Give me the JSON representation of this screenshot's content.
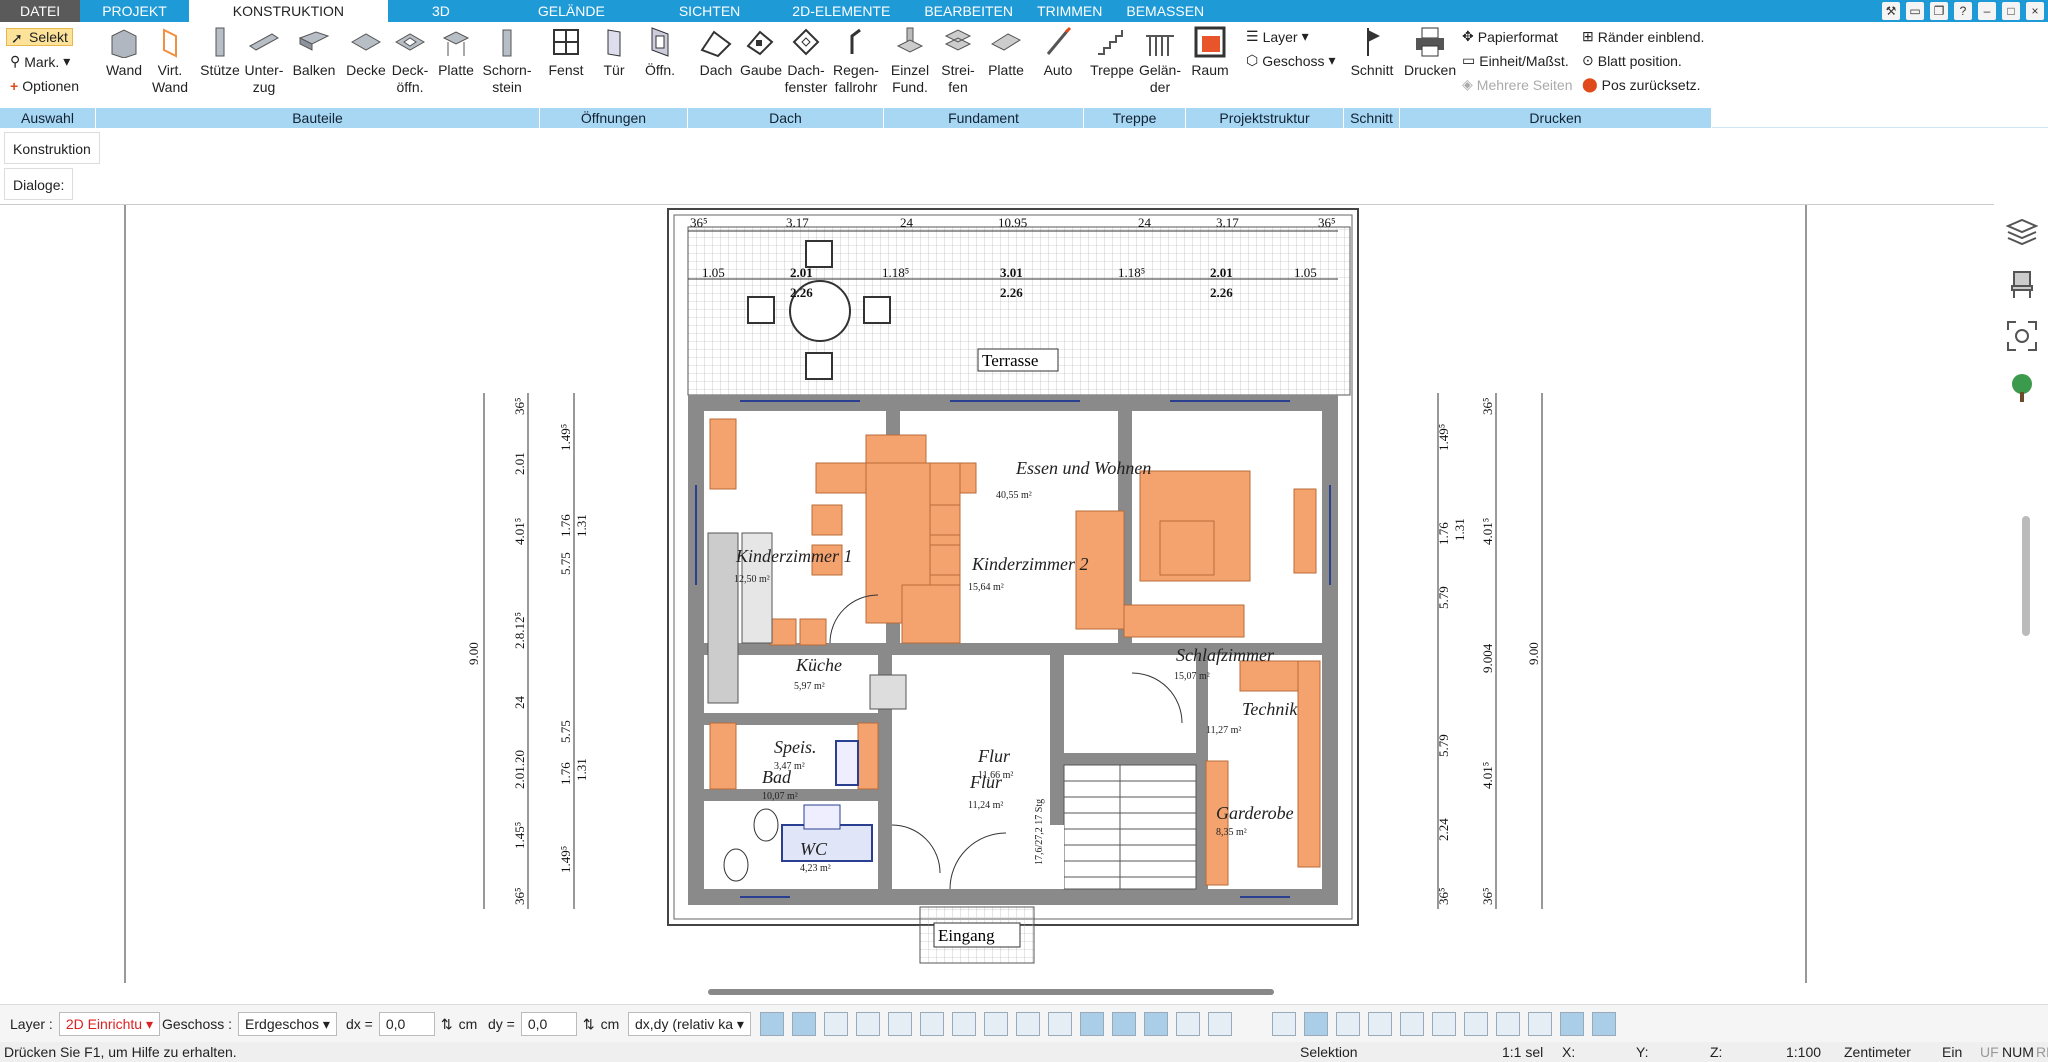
{
  "tabs": [
    {
      "label": "DATEI"
    },
    {
      "label": "PROJEKT"
    },
    {
      "label": "KONSTRUKTION"
    },
    {
      "label": "3D"
    },
    {
      "label": "GELÄNDE"
    },
    {
      "label": "SICHTEN"
    },
    {
      "label": "2D-ELEMENTE"
    },
    {
      "label": "BEARBEITEN"
    },
    {
      "label": "TRIMMEN"
    },
    {
      "label": "BEMASSEN"
    }
  ],
  "ribbon": {
    "auswahl": {
      "label": "Auswahl",
      "selekt": "Selekt",
      "mark": "Mark.",
      "optionen": "Optionen"
    },
    "bauteile": {
      "label": "Bauteile",
      "wand": "Wand",
      "virt": "Virt.\nWand",
      "stuetze": "Stütze",
      "unterzug": "Unter-\nzug",
      "balken": "Balken",
      "decke": "Decke",
      "deckoeff": "Deck-\nöffn.",
      "platte": "Platte",
      "schorn": "Schorn-\nstein"
    },
    "oeffnungen": {
      "label": "Öffnungen",
      "fenst": "Fenst",
      "tuer": "Tür",
      "oeffn": "Öffn."
    },
    "dach": {
      "label": "Dach",
      "dach": "Dach",
      "gaube": "Gaube",
      "dachfenster": "Dach-\nfenster",
      "regen": "Regen-\nfallrohr"
    },
    "fundament": {
      "label": "Fundament",
      "einzel": "Einzel\nFund.",
      "streifen": "Strei-\nfen",
      "platte": "Platte",
      "auto": "Auto"
    },
    "treppe": {
      "label": "Treppe",
      "treppe": "Treppe",
      "gelaender": "Gelän-\nder"
    },
    "projektstruktur": {
      "label": "Projektstruktur",
      "raum": "Raum",
      "layer": "Layer",
      "geschoss": "Geschoss"
    },
    "schnitt": {
      "label": "Schnitt",
      "schnitt": "Schnitt"
    },
    "drucken": {
      "label": "Drucken",
      "drucken": "Drucken",
      "papierformat": "Papierformat",
      "einheit": "Einheit/Maßst.",
      "mehrere": "Mehrere Seiten",
      "raender": "Ränder einblend.",
      "blatt": "Blatt position.",
      "pos": "Pos zurücksetz."
    }
  },
  "panel": {
    "title": "Konstruktion",
    "dialoge": "Dialoge:"
  },
  "plan": {
    "rooms": {
      "terrasse": "Terrasse",
      "essen": "Essen und Wohnen",
      "essen_area": "40,55 m²",
      "kinder1": "Kinderzimmer 1",
      "kinder1_area": "12,50 m²",
      "kinder2": "Kinderzimmer 2",
      "kinder2_area": "15,64 m²",
      "kueche": "Küche",
      "kueche_area": "5,97 m²",
      "schlaf": "Schlafzimmer",
      "schlaf_area": "15,07 m²",
      "technik": "Technik",
      "technik_area": "11,27 m²",
      "speis": "Speis.",
      "speis_area": "3,47 m²",
      "bad": "Bad",
      "bad_area": "10,07 m²",
      "flur1": "Flur",
      "flur2": "Flur",
      "flur_area1": "11,66 m²",
      "flur_area2": "11,24 m²",
      "garderobe": "Garderobe",
      "garderobe_area": "8,35 m²",
      "wc": "WC",
      "wc_area": "4,23 m²",
      "eingang": "Eingang",
      "stairs": "17,6/27,2\n17 Stg"
    },
    "dims_top1": [
      "36⁵",
      "3.17",
      "24",
      "10.95",
      "24",
      "3.17",
      "36⁵"
    ],
    "dims_top2": [
      "1.05",
      "2.01",
      "1.18⁵",
      "3.01",
      "1.18⁵",
      "2.01",
      "1.05"
    ],
    "dims_top3": [
      "2.26",
      "2.26",
      "2.26"
    ],
    "dims_left_outer": "9.00",
    "dims_left_mid": [
      "36⁵",
      "2.01",
      "4.01⁵",
      "2.8.12⁵",
      "24",
      "2.01.20",
      "1.45⁵",
      "36⁵"
    ],
    "dims_left_inner": [
      "1.49⁵",
      "5.75",
      "1.76",
      "1.31",
      "1.76",
      "5.75",
      "1.31",
      "1.49⁵"
    ],
    "dims_right_outer": "9.00",
    "dims_right_mid": [
      "1.49⁵",
      "36⁵",
      "1.76",
      "1.31",
      "5.79",
      "9.004",
      "4.01⁵",
      "5.79",
      "4.01⁵",
      "2.24",
      "36⁵",
      "36⁵"
    ]
  },
  "status": {
    "layer_label": "Layer :",
    "layer_value": "2D Einrichtu",
    "geschoss_label": "Geschoss :",
    "geschoss_value": "Erdgeschos",
    "dx_label": "dx =",
    "dx_value": "0,0",
    "dy_label": "dy =",
    "dy_value": "0,0",
    "unit": "cm",
    "mode_value": "dx,dy (relativ ka"
  },
  "help": {
    "text": "Drücken Sie F1, um Hilfe zu erhalten.",
    "selektion": "Selektion",
    "sel": "1:1 sel",
    "x": "X:",
    "y": "Y:",
    "z": "Z:",
    "scale": "1:100",
    "units": "Zentimeter",
    "ein": "Ein",
    "uf": "UF",
    "num": "NUM",
    "rf": "RF"
  },
  "colors": {
    "accent": "#1e9ad6",
    "groupbar": "#a8d7f3",
    "furniture": "#f2a46b",
    "wall": "#8a8a8a"
  }
}
